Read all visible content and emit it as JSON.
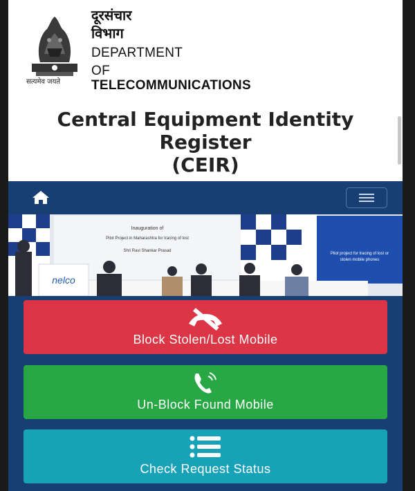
{
  "header": {
    "hindi_line1": "दूरसंचार",
    "hindi_line2": "विभाग",
    "dept_line1": "DEPARTMENT",
    "dept_line2": "OF",
    "dept_line3": "TELECOMMUNICATIONS",
    "motto": "सत्यमेव जयते",
    "title_line1": "Central Equipment Identity",
    "title_line2": "Register",
    "title_line3": "(CEIR)"
  },
  "banner": {
    "left_sign": "nelco",
    "center_text_1": "Inauguration of",
    "center_text_2": "Pilot Project in Maharashtra for tracing of lost",
    "center_text_3": "Shri Ravi Shankar Prasad",
    "right_text_1": "Pilot project for tracing of lost or",
    "right_text_2": "stolen mobile phones"
  },
  "actions": {
    "block_label": "Block Stolen/Lost Mobile",
    "unblock_label": "Un-Block Found Mobile",
    "status_label": "Check Request Status"
  },
  "colors": {
    "navbar": "#173f73",
    "block": "#dc3545",
    "unblock": "#28a745",
    "status": "#17a2b8"
  },
  "icons": {
    "home": "home-icon",
    "menu": "hamburger-menu-icon",
    "block": "phone-slash-icon",
    "unblock": "phone-volume-icon",
    "status": "list-icon"
  }
}
